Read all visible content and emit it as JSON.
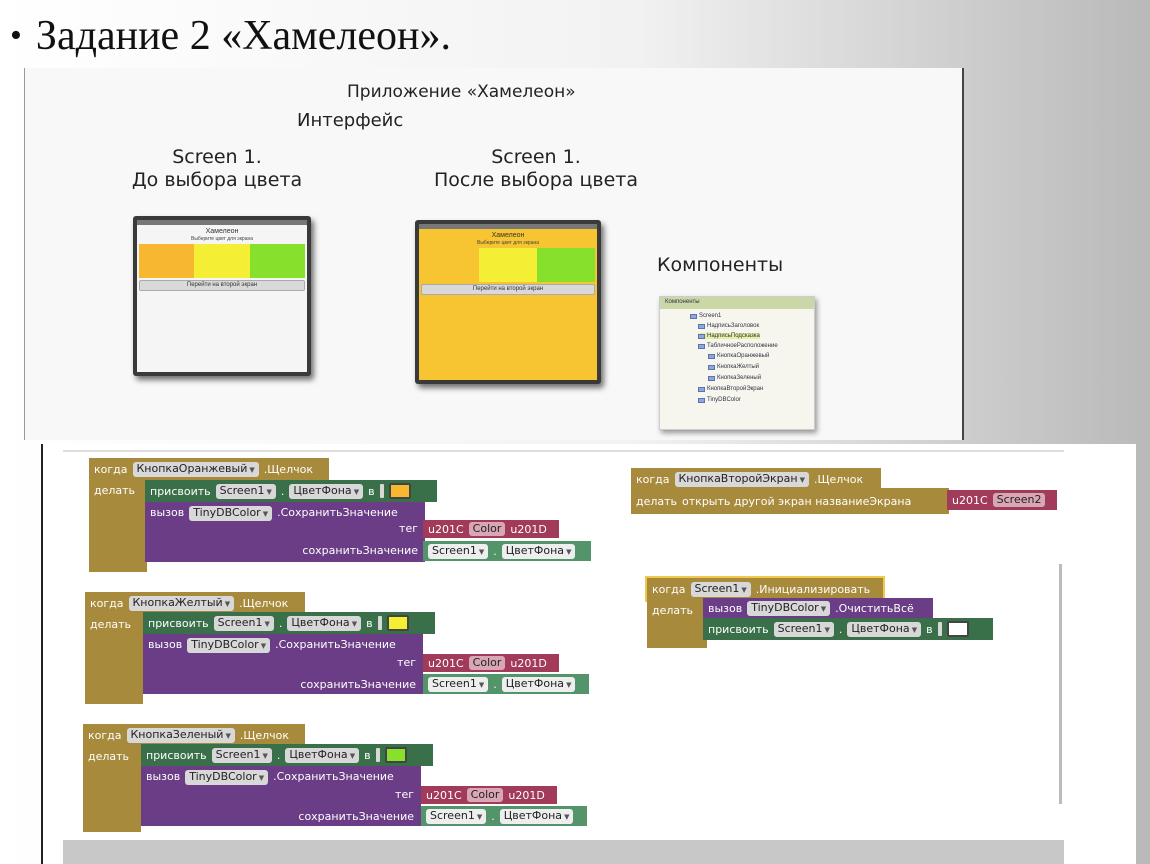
{
  "slide": {
    "bullet": "•",
    "title": "Задание 2 «Хамелеон»."
  },
  "top_panel": {
    "app_title": "Приложение «Хамелеон»",
    "interface_label": "Интерфейс",
    "screen_before": {
      "line1": "Screen 1.",
      "line2": "До выбора цвета"
    },
    "screen_after": {
      "line1": "Screen 1.",
      "line2": "После выбора цвета"
    },
    "components_label": "Компоненты",
    "phone": {
      "title": "Хамелеон",
      "subtitle": "Выберите цвет для экрана",
      "nav_button": "Перейти на второй экран"
    },
    "components_panel": {
      "header": "Компоненты",
      "items": [
        "Screen1",
        "НадписьЗаголовок",
        "НадписьПодсказка",
        "ТабличноеРасположение",
        "КнопкаОранжевый",
        "КнопкаЖелтый",
        "КнопкаЗеленый",
        "КнопкаВторойЭкран",
        "TinyDBColor"
      ]
    },
    "colors": {
      "orange": "#f7b731",
      "yellow": "#f4ee34",
      "green": "#86e02c",
      "after_bg": "#f7c531"
    }
  },
  "blocks": {
    "when": "когда",
    "do": "делать",
    "click": ".Щелчок",
    "set": "присвоить",
    "to": "в",
    "dot": ".",
    "call": "вызов",
    "store_value": ".СохранитьЗначение",
    "tag": "тег",
    "value_to_store": "сохранитьЗначение",
    "screen1": "Screen1",
    "bgcolor": "ЦветФона",
    "tinydb": "TinyDBColor",
    "quote_open": "u201C",
    "quote_close": "u201D",
    "color_text": "Color",
    "orange_button": "КнопкаОранжевый",
    "yellow_button": "КнопкаЖелтый",
    "green_button": "КнопкаЗеленый",
    "second_screen_button": "КнопкаВторойЭкран",
    "open_screen": "открыть другой экран  названиеЭкрана",
    "screen2": "Screen2",
    "initialize": ".Инициализировать",
    "clear_all": ".ОчиститьВсё",
    "swatch_orange": "#f7b731",
    "swatch_yellow": "#f4ee34",
    "swatch_green": "#86e02c",
    "swatch_white": "#ffffff"
  }
}
